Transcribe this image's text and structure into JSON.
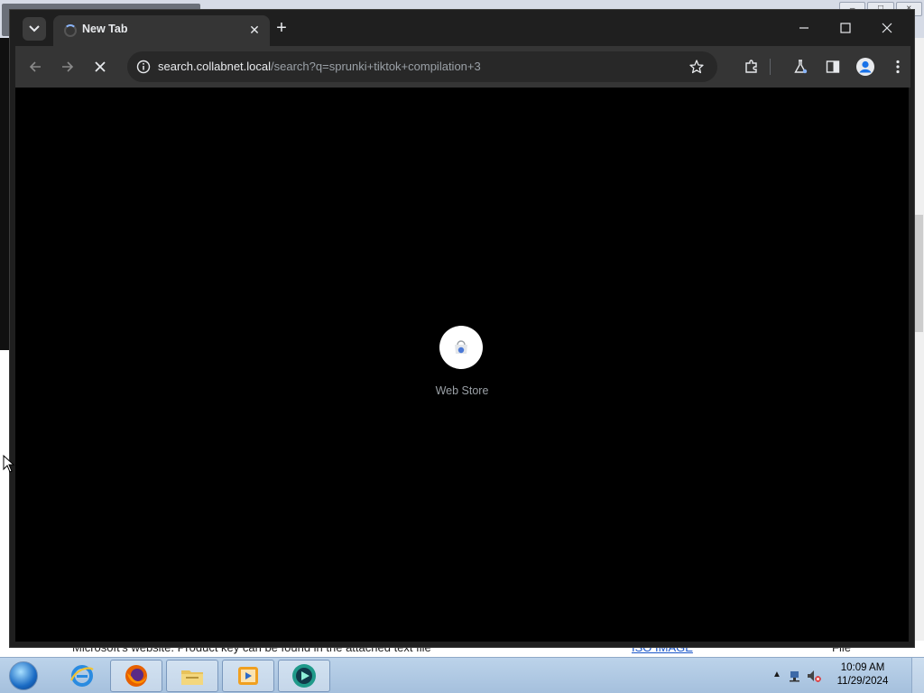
{
  "browser": {
    "tab": {
      "title": "New Tab"
    },
    "url": {
      "host": "search.collabnet.local",
      "path": "/search?q=sprunki+tiktok+compilation+3"
    },
    "content": {
      "shortcut_label": "Web Store"
    }
  },
  "background_page": {
    "line_text": "Microsoft's website. Product key can be found in the attached text file",
    "link_text": "ISO IMAGE",
    "column_text": "File"
  },
  "taskbar": {
    "apps": [
      "internet-explorer",
      "firefox",
      "file-explorer",
      "media-player",
      "chrome-app"
    ],
    "clock": {
      "time": "10:09 AM",
      "date": "11/29/2024"
    }
  },
  "colors": {
    "chrome_dark": "#1f1f1f",
    "toolbar": "#353535",
    "accent": "#8ab4f8"
  }
}
